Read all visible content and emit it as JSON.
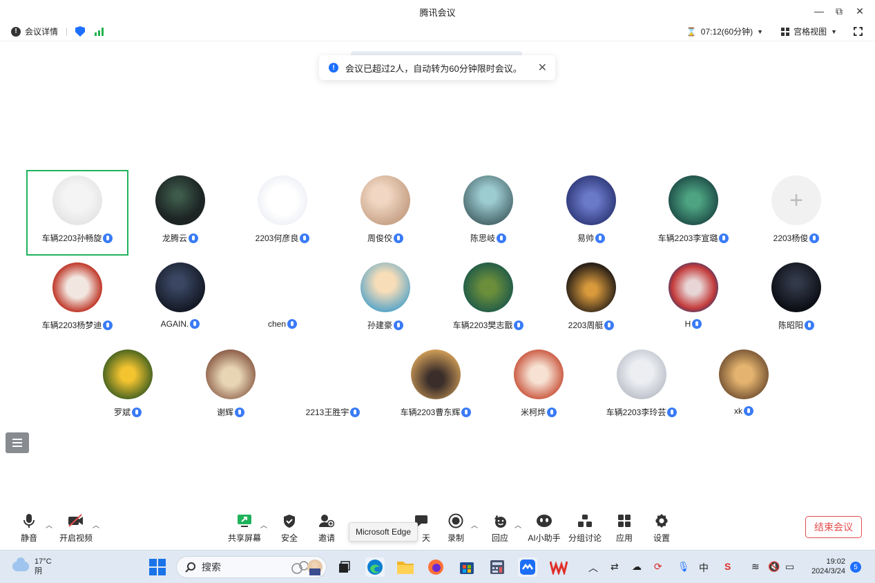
{
  "window": {
    "title": "腾讯会议",
    "minimize": "—",
    "restore": "⧉",
    "close": "✕"
  },
  "infobar": {
    "details_label": "会议详情",
    "timer": "07:12(60分钟)",
    "view_label": "宫格视图"
  },
  "notice": {
    "text": "会议已超过2人，自动转为60分钟限时会议。",
    "close": "✕"
  },
  "participants": [
    {
      "name": "车辆2203孙畅旋",
      "speaking": true
    },
    {
      "name": "龙腾云"
    },
    {
      "name": "2203何彦良"
    },
    {
      "name": "周俊佼"
    },
    {
      "name": "陈思岐"
    },
    {
      "name": "易帅"
    },
    {
      "name": "车辆2203李宣璐"
    },
    {
      "name": "2203杨俊",
      "placeholder": "+"
    },
    {
      "name": "车辆2203杨梦迪"
    },
    {
      "name": "AGAIN."
    },
    {
      "name": "chen"
    },
    {
      "name": "孙建豪"
    },
    {
      "name": "车辆2203樊志戬"
    },
    {
      "name": "2203周艇"
    },
    {
      "name": "H"
    },
    {
      "name": "陈昭阳"
    },
    {
      "name": "罗斌"
    },
    {
      "name": "谢辉"
    },
    {
      "name": "2213王胜宇"
    },
    {
      "name": "车辆2203曹东辉"
    },
    {
      "name": "米柯烨"
    },
    {
      "name": "车辆2203李玲芸"
    },
    {
      "name": "xk"
    }
  ],
  "toolbar": {
    "mute": "静音",
    "video": "开启视频",
    "share": "共享屏幕",
    "security": "安全",
    "invite": "邀请",
    "chat": "天",
    "record": "录制",
    "react": "回应",
    "ai": "AI小助手",
    "breakout": "分组讨论",
    "apps": "应用",
    "settings": "设置",
    "end": "结束会议",
    "tooltip": "Microsoft Edge"
  },
  "taskbar": {
    "temp": "17°C",
    "weather": "阴",
    "search_placeholder": "搜索",
    "time": "19:02",
    "date": "2024/3/24",
    "notifications": "5"
  }
}
